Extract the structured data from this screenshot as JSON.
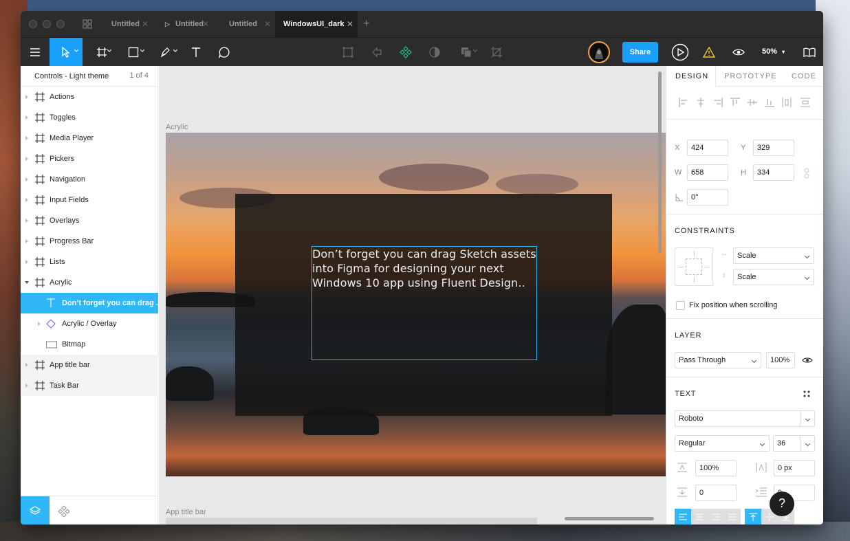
{
  "tabs": [
    {
      "label": "Untitled",
      "kind": "design"
    },
    {
      "label": "Untitled",
      "kind": "prototype"
    },
    {
      "label": "Untitled",
      "kind": "design"
    },
    {
      "label": "WindowsUI_dark",
      "kind": "design",
      "active": true
    }
  ],
  "toolbar": {
    "share_label": "Share",
    "zoom_label": "50%",
    "icons": [
      "menu-icon",
      "move-tool-icon",
      "frame-tool-icon",
      "shape-tool-icon",
      "pen-tool-icon",
      "text-tool-icon",
      "comment-tool-icon",
      "component-icon",
      "instance-icon",
      "create-component-icon",
      "mask-icon",
      "boolean-icon",
      "crop-icon",
      "present-icon",
      "warning-icon",
      "preview-icon",
      "library-icon"
    ]
  },
  "left_panel": {
    "page_name": "Controls - Light theme",
    "page_count": "1 of 4",
    "layers": [
      {
        "label": "Actions"
      },
      {
        "label": "Toggles"
      },
      {
        "label": "Media Player"
      },
      {
        "label": "Pickers"
      },
      {
        "label": "Navigation"
      },
      {
        "label": "Input Fields"
      },
      {
        "label": "Overlays"
      },
      {
        "label": "Progress Bar"
      },
      {
        "label": "Lists"
      },
      {
        "label": "Acrylic"
      },
      {
        "label": "Don’t forget you can drag ..."
      },
      {
        "label": "Acrylic / Overlay"
      },
      {
        "label": "Bitmap"
      },
      {
        "label": "App title bar"
      },
      {
        "label": "Task Bar"
      }
    ]
  },
  "canvas": {
    "frame_label_acrylic": "Acrylic",
    "frame_label_app_title_bar": "App title bar",
    "text_content": "Don’t forget you can drag Sketch assets\ninto Figma for designing your next\nWindows 10 app using Fluent Design.."
  },
  "right_panel": {
    "tabs": [
      "DESIGN",
      "PROTOTYPE",
      "CODE"
    ],
    "x_label": "X",
    "x_value": "424",
    "y_label": "Y",
    "y_value": "329",
    "w_label": "W",
    "w_value": "658",
    "h_label": "H",
    "h_value": "334",
    "rotation_value": "0°",
    "constraints_title": "CONSTRAINTS",
    "constraint_h": "Scale",
    "constraint_v": "Scale",
    "fix_position_label": "Fix position when scrolling",
    "layer_title": "LAYER",
    "blend_mode": "Pass Through",
    "opacity": "100%",
    "text_title": "TEXT",
    "font_family": "Roboto",
    "font_weight": "Regular",
    "font_size": "36",
    "line_height": "100%",
    "letter_spacing": "0 px",
    "paragraph_spacing": "0",
    "paragraph_indent": "0"
  },
  "help_label": "?",
  "colors": {
    "accent": "#18a0fb",
    "selection": "#30b7f7",
    "toolbar": "#2c2c2c",
    "avatar_ring": "#f2a640"
  }
}
